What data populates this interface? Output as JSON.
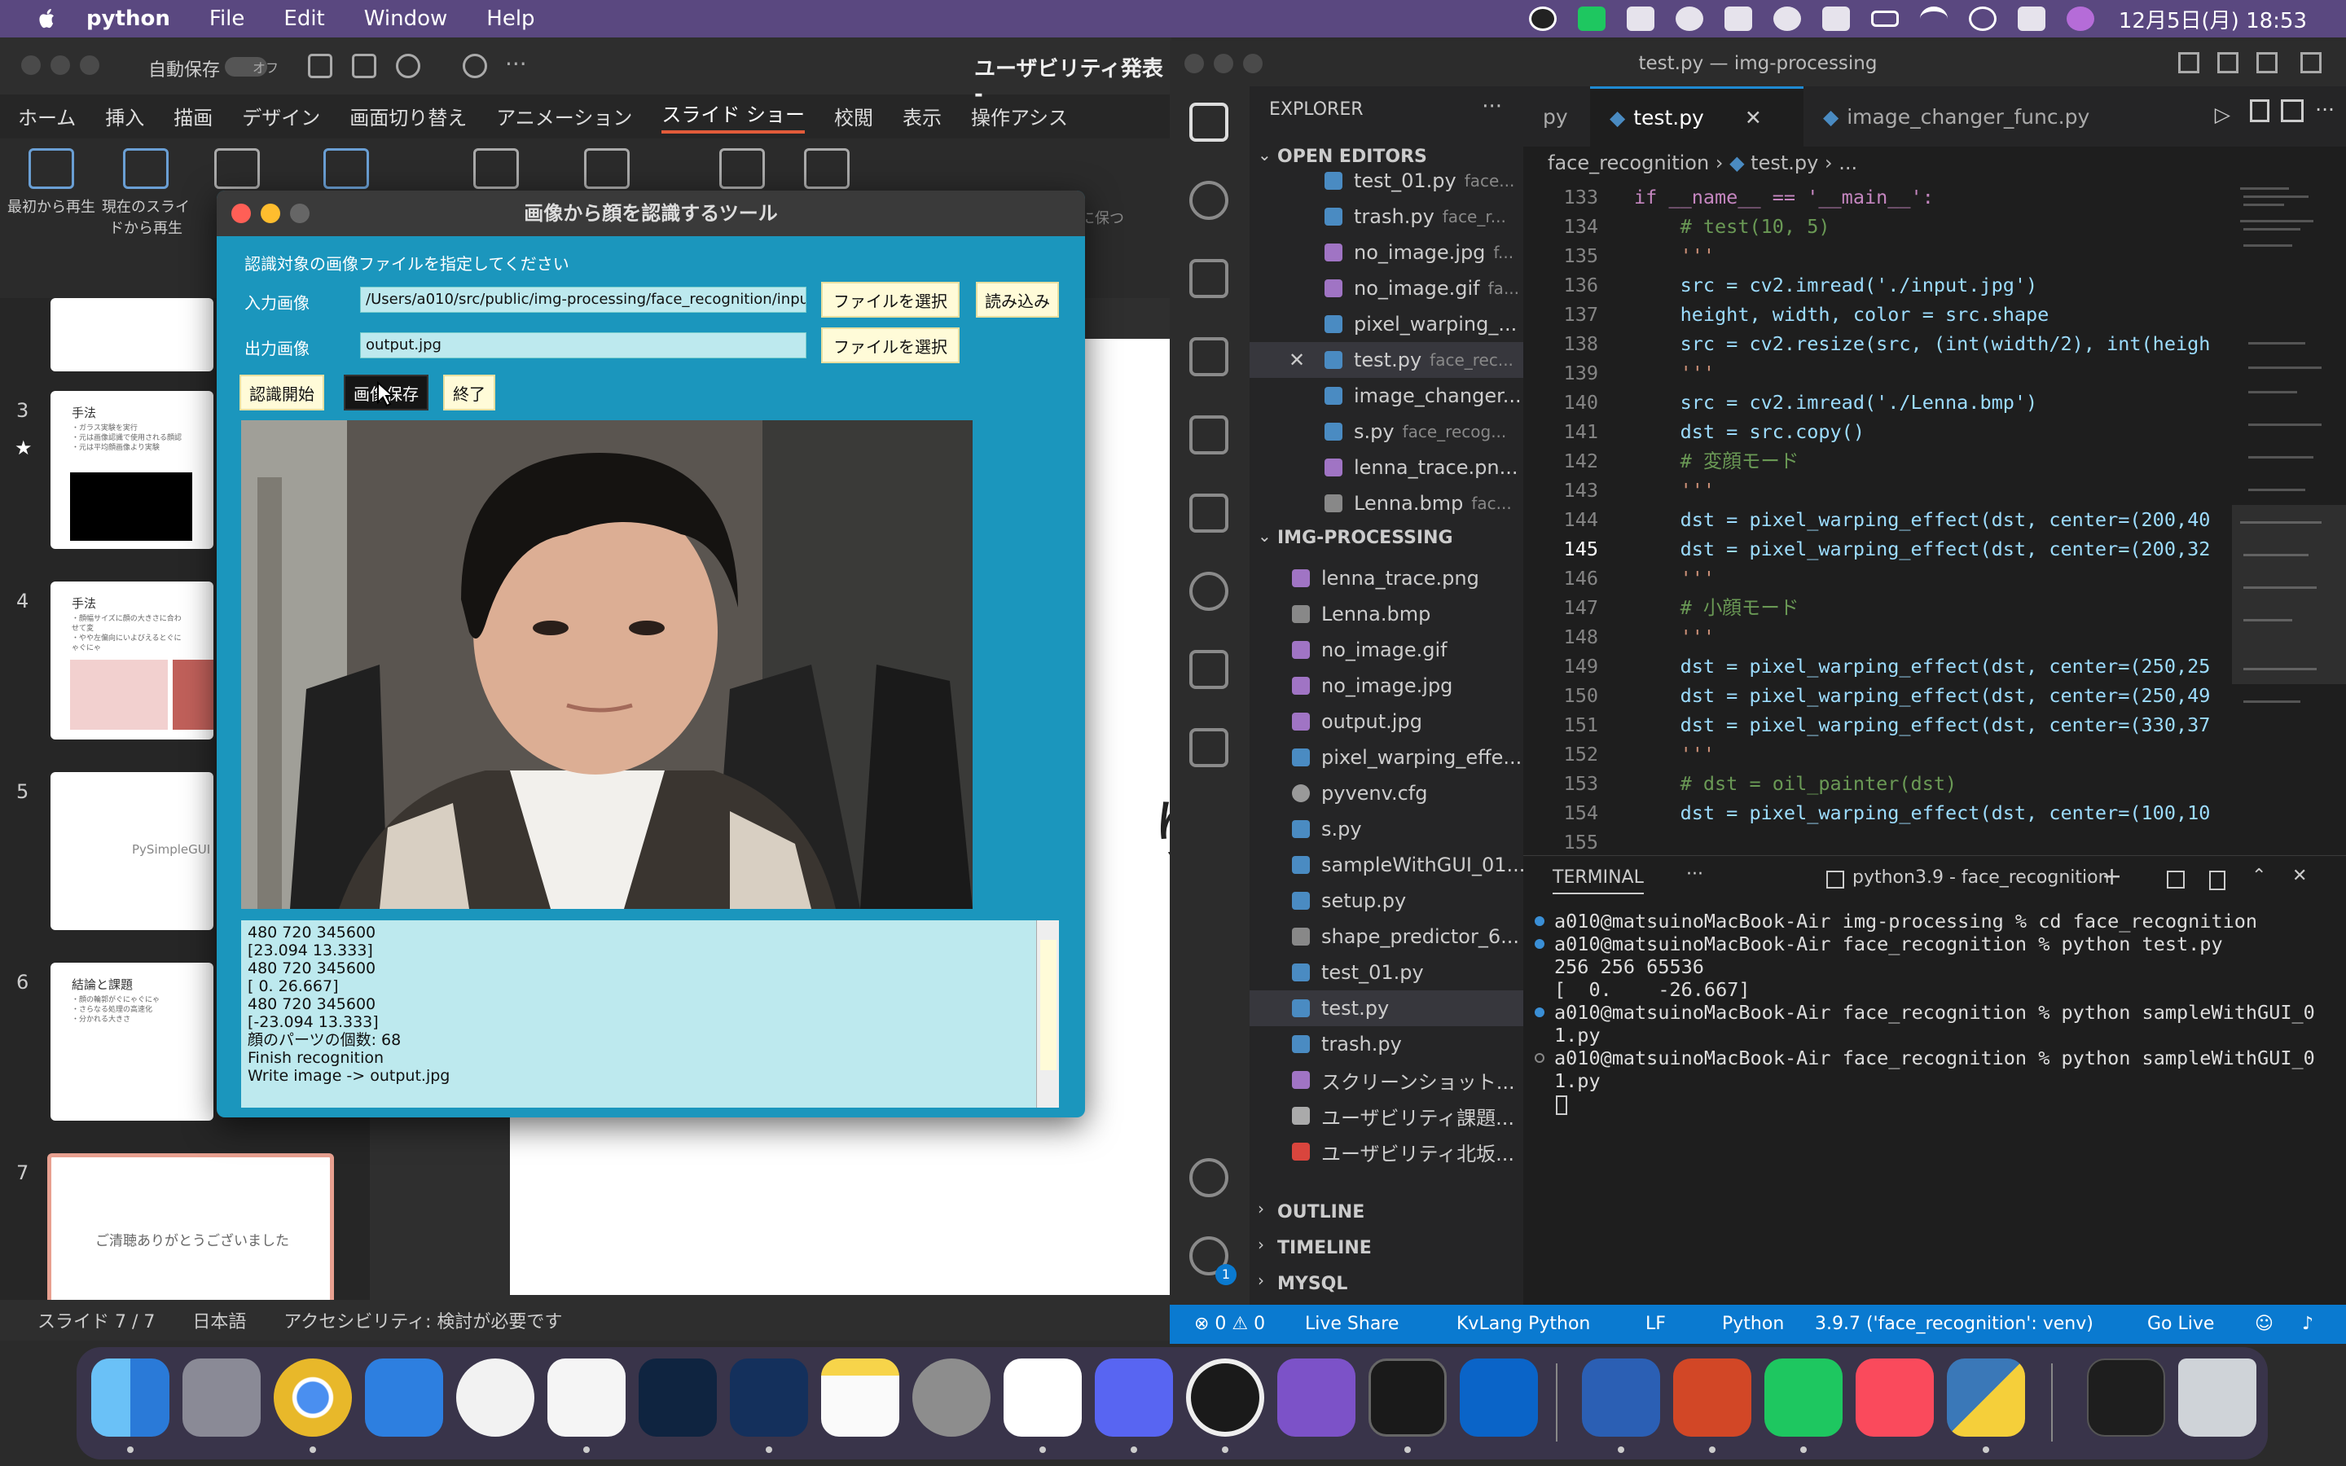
{
  "menubar": {
    "app": "python",
    "items": [
      "File",
      "Edit",
      "Window",
      "Help"
    ],
    "clock": "12月5日(月) 18:53"
  },
  "ppt": {
    "autosave_label": "自動保存",
    "autosave_state": "オフ",
    "doc_title": "ユーザビリティ発表 -",
    "tabs": [
      "ホーム",
      "挿入",
      "描画",
      "デザイン",
      "画面切り替え",
      "アニメーション",
      "スライド ショー",
      "校閲",
      "表示",
      "操作アシス"
    ],
    "active_tab": "スライド ショー",
    "ribbon": {
      "from_start": "最初から再生",
      "from_current": "現在のスライドから再生",
      "keep_slide_option": "スライドを最新の状態に保つ"
    },
    "slides": [
      {
        "num": "3",
        "title": "手法",
        "lines": "・ガラス実験を実行\n・元は画像認識で使用される顔認\n・元は平均顔画像より実験"
      },
      {
        "num": "4",
        "title": "手法",
        "lines": "・顔幅サイズに顔の大きさに合わせて変\n・やや左偏向にいよびえるとぐにゃぐにゃ"
      },
      {
        "num": "5",
        "title": "PySimpleGUI",
        "lines": ""
      },
      {
        "num": "6",
        "title": "結論と課題",
        "lines": "・顔の輪郭がぐにゃぐにゃ\n・さらなる処理の高速化\n・分かれる大きさ"
      },
      {
        "num": "7",
        "title": "ご清聴ありがとうございました",
        "lines": ""
      }
    ],
    "slide_text": "り",
    "status": {
      "slide": "スライド 7 / 7",
      "language": "日本語",
      "accessibility": "アクセシビリティ: 検討が必要です"
    }
  },
  "tool": {
    "title": "画像から顔を認識するツール",
    "instruction": "認識対象の画像ファイルを指定してください",
    "input_label": "入力画像",
    "input_value": "/Users/a010/src/public/img-processing/face_recognition/input.jpg",
    "output_label": "出力画像",
    "output_value": "output.jpg",
    "browse_label": "ファイルを選択",
    "load_label": "読み込み",
    "start_label": "認識開始",
    "save_label": "画像保存",
    "exit_label": "終了",
    "log": [
      "480 720 345600",
      "[23.094 13.333]",
      "480 720 345600",
      "[ 0.    26.667]",
      "480 720 345600",
      "[-23.094  13.333]",
      "顔のパーツの個数: 68",
      "Finish recognition",
      "Write image -> output.jpg"
    ]
  },
  "vscode": {
    "title": "test.py — img-processing",
    "explorer_label": "EXPLORER",
    "open_editors_label": "OPEN EDITORS",
    "open_editors": [
      {
        "name": "test_01.py",
        "dir": "face..."
      },
      {
        "name": "trash.py",
        "dir": "face_r..."
      },
      {
        "name": "no_image.jpg",
        "dir": "f..."
      },
      {
        "name": "no_image.gif",
        "dir": "fa..."
      },
      {
        "name": "pixel_warping_...",
        "dir": ""
      },
      {
        "name": "test.py",
        "dir": "face_rec..."
      },
      {
        "name": "image_changer...",
        "dir": ""
      },
      {
        "name": "s.py",
        "dir": "face_recog..."
      },
      {
        "name": "lenna_trace.pn...",
        "dir": ""
      },
      {
        "name": "Lenna.bmp",
        "dir": "fac..."
      }
    ],
    "folder_label": "IMG-PROCESSING",
    "files": [
      "lenna_trace.png",
      "Lenna.bmp",
      "no_image.gif",
      "no_image.jpg",
      "output.jpg",
      "pixel_warping_effe...",
      "pyvenv.cfg",
      "s.py",
      "sampleWithGUI_01...",
      "setup.py",
      "shape_predictor_6...",
      "test_01.py",
      "test.py",
      "trash.py",
      "スクリーンショット...",
      "ユーザビリティ課題...",
      "ユーザビリティ北坂..."
    ],
    "outline_label": "OUTLINE",
    "timeline_label": "TIMELINE",
    "mysql_label": "MYSQL",
    "tabs": [
      "py",
      "test.py",
      "image_changer_func.py"
    ],
    "breadcrumb": [
      "face_recognition",
      "test.py",
      "..."
    ],
    "code": [
      {
        "n": "133",
        "t": "if __name__ == '__main__':"
      },
      {
        "n": "134",
        "t": "    # test(10, 5)"
      },
      {
        "n": "135",
        "t": "    '''"
      },
      {
        "n": "136",
        "t": "    src = cv2.imread('./input.jpg')"
      },
      {
        "n": "137",
        "t": "    height, width, color = src.shape"
      },
      {
        "n": "138",
        "t": "    src = cv2.resize(src, (int(width/2), int(heigh"
      },
      {
        "n": "139",
        "t": "    '''"
      },
      {
        "n": "140",
        "t": "    src = cv2.imread('./Lenna.bmp')"
      },
      {
        "n": "141",
        "t": "    dst = src.copy()"
      },
      {
        "n": "142",
        "t": "    # 変顔モード"
      },
      {
        "n": "143",
        "t": "    '''"
      },
      {
        "n": "144",
        "t": "    dst = pixel_warping_effect(dst, center=(200,40"
      },
      {
        "n": "145",
        "t": "    dst = pixel_warping_effect(dst, center=(200,32"
      },
      {
        "n": "146",
        "t": "    '''"
      },
      {
        "n": "147",
        "t": "    # 小顔モード"
      },
      {
        "n": "148",
        "t": "    '''"
      },
      {
        "n": "149",
        "t": "    dst = pixel_warping_effect(dst, center=(250,25"
      },
      {
        "n": "150",
        "t": "    dst = pixel_warping_effect(dst, center=(250,49"
      },
      {
        "n": "151",
        "t": "    dst = pixel_warping_effect(dst, center=(330,37"
      },
      {
        "n": "152",
        "t": "    '''"
      },
      {
        "n": "153",
        "t": "    # dst = oil_painter(dst)"
      },
      {
        "n": "154",
        "t": "    dst = pixel_warping_effect(dst, center=(100,10"
      },
      {
        "n": "155",
        "t": ""
      }
    ],
    "current_line": "145",
    "terminal_label": "TERMINAL",
    "terminal_shell": "python3.9 - face_recognition",
    "terminal_lines": [
      "a010@matsuinoMacBook-Air img-processing % cd face_recognition",
      "a010@matsuinoMacBook-Air face_recognition % python test.py",
      "256 256 65536",
      "[  0.    -26.667]",
      "a010@matsuinoMacBook-Air face_recognition % python sampleWithGUI_0",
      "1.py",
      "a010@matsuinoMacBook-Air face_recognition % python sampleWithGUI_0",
      "1.py"
    ],
    "status": {
      "problems": "⊗ 0 ⚠ 0",
      "live_share": "Live Share",
      "kvlang": "KvLang Python",
      "eol": "LF",
      "language": "Python",
      "interpreter": "3.9.7 ('face_recognition': venv)",
      "golive": "Go Live"
    },
    "badge": "1"
  },
  "dock": [
    "finder",
    "launchpad",
    "chrome",
    "xcode",
    "app-store",
    "vscode",
    "photoshop",
    "sourcetree",
    "notes",
    "system-preferences",
    "slack",
    "discord",
    "obs",
    "github-desktop",
    "terminal",
    "outlook",
    "word",
    "powerpoint",
    "line",
    "music",
    "python-launcher",
    "window-preview",
    "trash"
  ],
  "colors": {
    "menubar": "#5a4880",
    "tool_bg": "#1b96bd",
    "vscode_status": "#0a7ad0"
  }
}
